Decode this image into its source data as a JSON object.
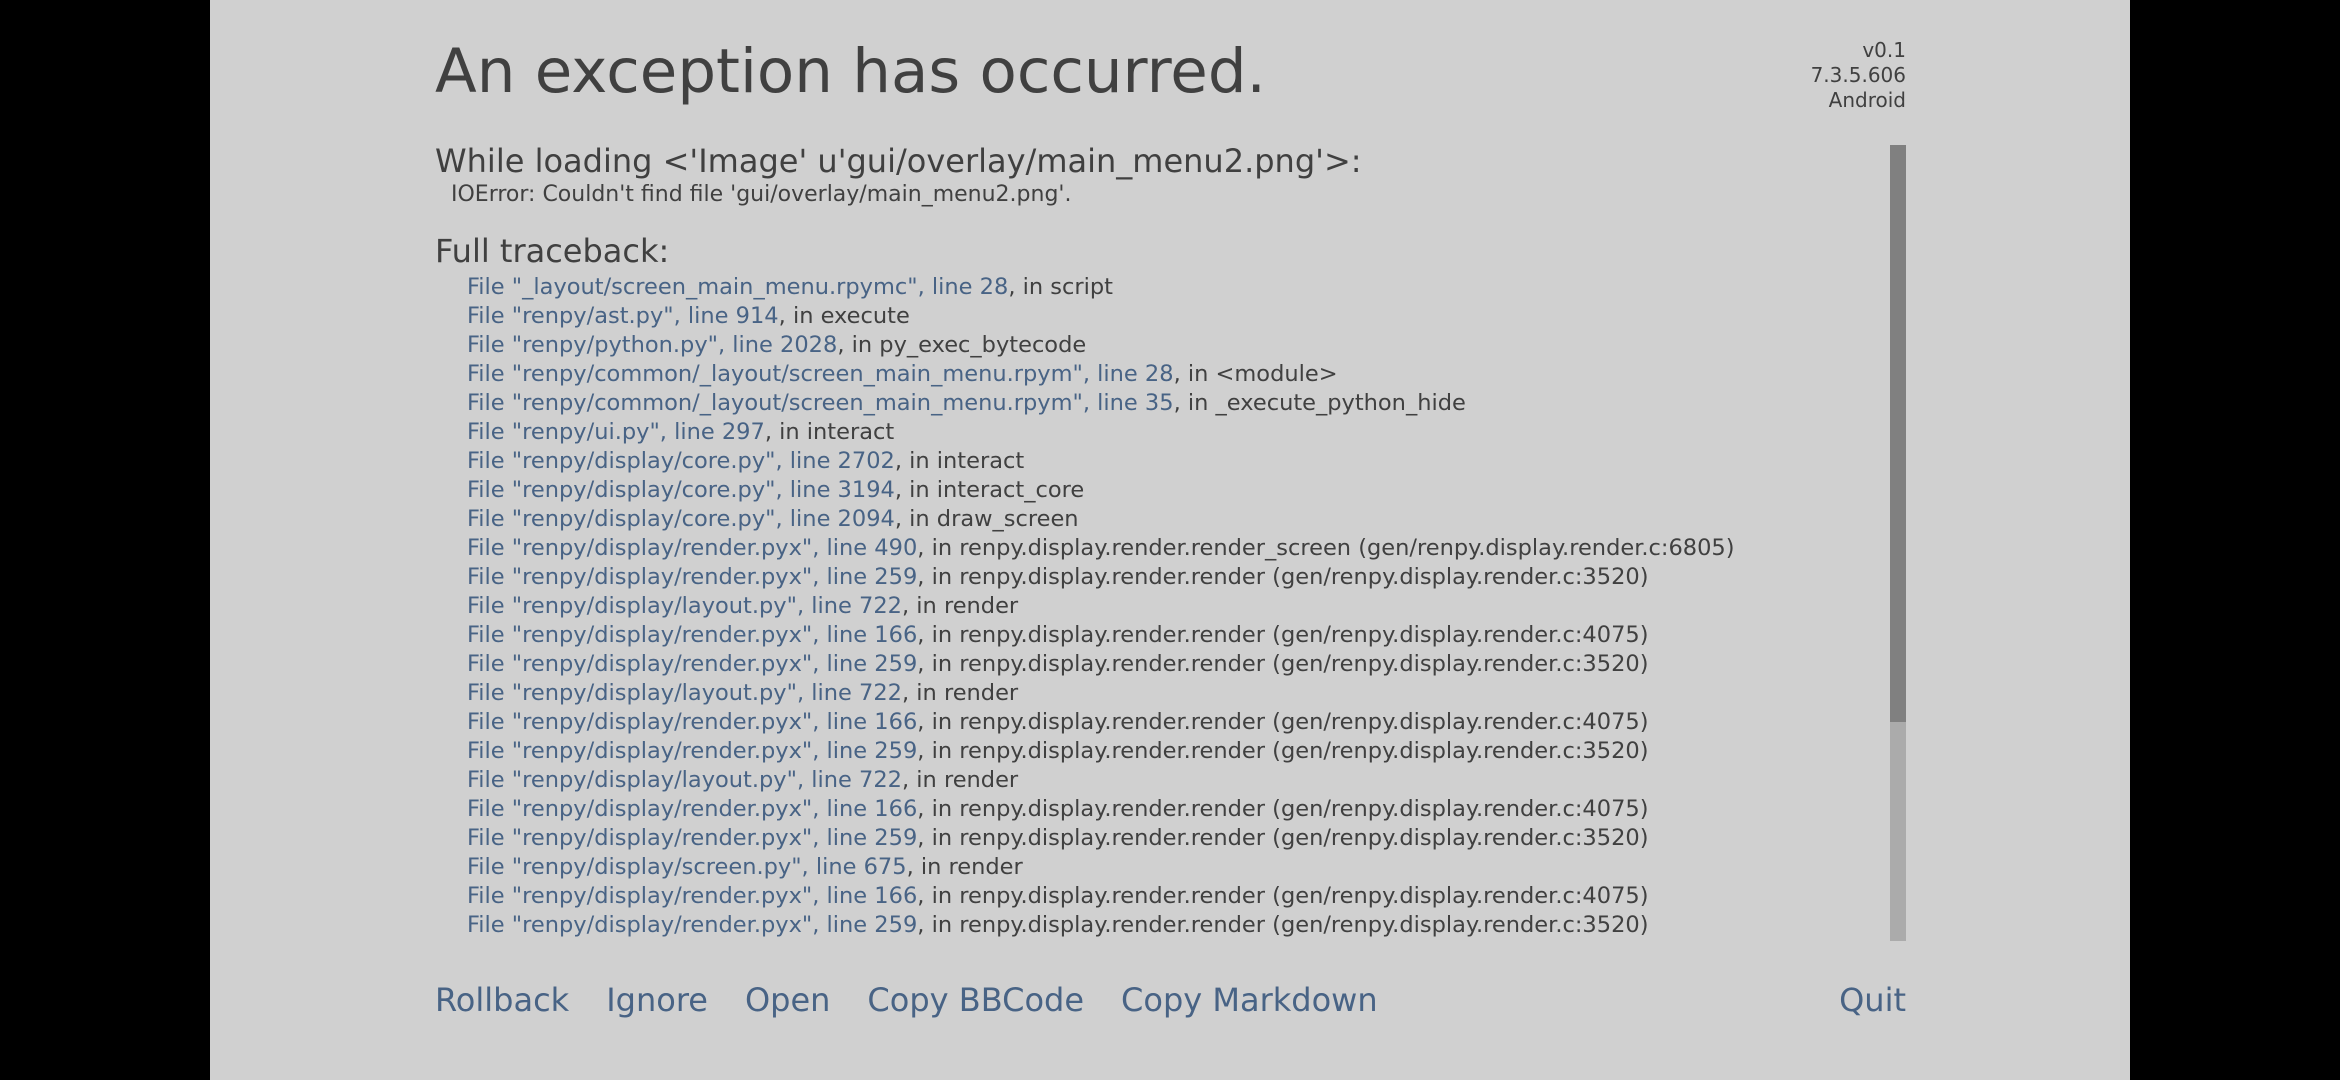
{
  "title": "An exception has occurred.",
  "version": {
    "game_version": "v0.1",
    "engine_version": "7.3.5.606",
    "platform": "Android"
  },
  "error": {
    "heading": "While loading <'Image' u'gui/overlay/main_menu2.png'>:",
    "message": "IOError: Couldn't find file 'gui/overlay/main_menu2.png'."
  },
  "traceback": {
    "heading": "Full traceback:",
    "lines": [
      {
        "file": "File \"_layout/screen_main_menu.rpymc\", line 28",
        "rest": ", in script"
      },
      {
        "file": "File \"renpy/ast.py\", line 914",
        "rest": ", in execute"
      },
      {
        "file": "File \"renpy/python.py\", line 2028",
        "rest": ", in py_exec_bytecode"
      },
      {
        "file": "File \"renpy/common/_layout/screen_main_menu.rpym\", line 28",
        "rest": ", in <module>"
      },
      {
        "file": "File \"renpy/common/_layout/screen_main_menu.rpym\", line 35",
        "rest": ", in _execute_python_hide"
      },
      {
        "file": "File \"renpy/ui.py\", line 297",
        "rest": ", in interact"
      },
      {
        "file": "File \"renpy/display/core.py\", line 2702",
        "rest": ", in interact"
      },
      {
        "file": "File \"renpy/display/core.py\", line 3194",
        "rest": ", in interact_core"
      },
      {
        "file": "File \"renpy/display/core.py\", line 2094",
        "rest": ", in draw_screen"
      },
      {
        "file": "File \"renpy/display/render.pyx\", line 490",
        "rest": ", in renpy.display.render.render_screen (gen/renpy.display.render.c:6805)"
      },
      {
        "file": "File \"renpy/display/render.pyx\", line 259",
        "rest": ", in renpy.display.render.render (gen/renpy.display.render.c:3520)"
      },
      {
        "file": "File \"renpy/display/layout.py\", line 722",
        "rest": ", in render"
      },
      {
        "file": "File \"renpy/display/render.pyx\", line 166",
        "rest": ", in renpy.display.render.render (gen/renpy.display.render.c:4075)"
      },
      {
        "file": "File \"renpy/display/render.pyx\", line 259",
        "rest": ", in renpy.display.render.render (gen/renpy.display.render.c:3520)"
      },
      {
        "file": "File \"renpy/display/layout.py\", line 722",
        "rest": ", in render"
      },
      {
        "file": "File \"renpy/display/render.pyx\", line 166",
        "rest": ", in renpy.display.render.render (gen/renpy.display.render.c:4075)"
      },
      {
        "file": "File \"renpy/display/render.pyx\", line 259",
        "rest": ", in renpy.display.render.render (gen/renpy.display.render.c:3520)"
      },
      {
        "file": "File \"renpy/display/layout.py\", line 722",
        "rest": ", in render"
      },
      {
        "file": "File \"renpy/display/render.pyx\", line 166",
        "rest": ", in renpy.display.render.render (gen/renpy.display.render.c:4075)"
      },
      {
        "file": "File \"renpy/display/render.pyx\", line 259",
        "rest": ", in renpy.display.render.render (gen/renpy.display.render.c:3520)"
      },
      {
        "file": "File \"renpy/display/screen.py\", line 675",
        "rest": ", in render"
      },
      {
        "file": "File \"renpy/display/render.pyx\", line 166",
        "rest": ", in renpy.display.render.render (gen/renpy.display.render.c:4075)"
      },
      {
        "file": "File \"renpy/display/render.pyx\", line 259",
        "rest": ", in renpy.display.render.render (gen/renpy.display.render.c:3520)"
      }
    ]
  },
  "scrollbar": {
    "thumb_fraction": 0.725,
    "position_fraction": 0.0
  },
  "buttons": {
    "rollback": "Rollback",
    "ignore": "Ignore",
    "open": "Open",
    "copy_bbcode": "Copy BBCode",
    "copy_markdown": "Copy Markdown",
    "quit": "Quit"
  },
  "colors": {
    "background": "#d0d0d0",
    "text": "#404040",
    "link": "#486385",
    "scrollbar_track": "#ababab",
    "scrollbar_thumb": "#808080",
    "letterbox": "#000000"
  }
}
